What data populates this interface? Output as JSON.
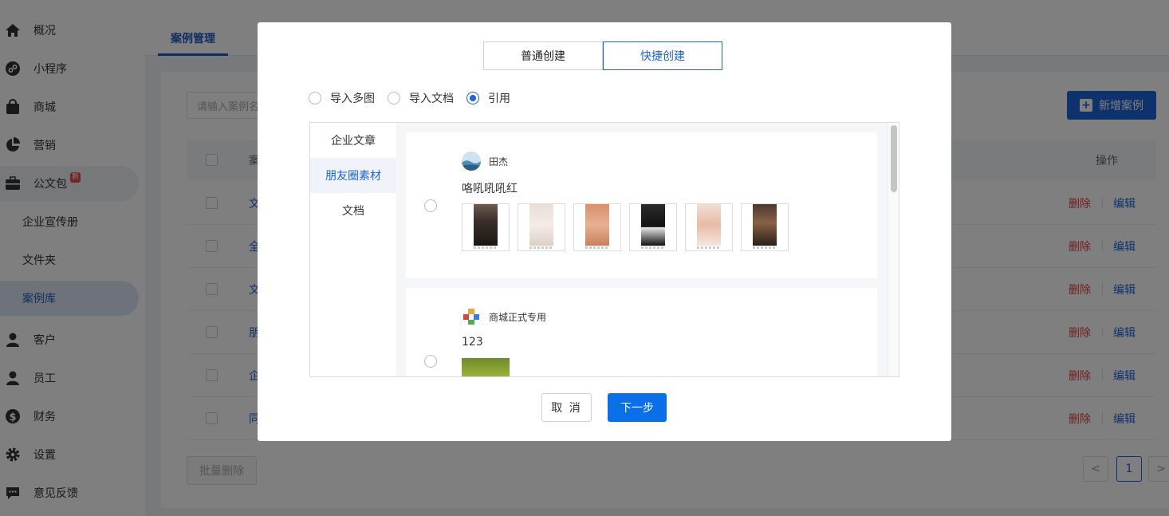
{
  "sidebar": {
    "items": [
      {
        "label": "概况",
        "icon": "home-icon"
      },
      {
        "label": "小程序",
        "icon": "mini-program-icon"
      },
      {
        "label": "商城",
        "icon": "shopping-bag-icon"
      },
      {
        "label": "营销",
        "icon": "pie-chart-icon"
      },
      {
        "label": "公文包",
        "icon": "briefcase-icon",
        "badge": "新"
      },
      {
        "label": "客户",
        "icon": "customer-icon"
      },
      {
        "label": "员工",
        "icon": "person-icon"
      },
      {
        "label": "财务",
        "icon": "dollar-icon"
      },
      {
        "label": "设置",
        "icon": "gear-icon"
      },
      {
        "label": "意见反馈",
        "icon": "feedback-icon"
      }
    ],
    "subitems": [
      "企业宣传册",
      "文件夹",
      "案例库"
    ],
    "active_subitem": "案例库"
  },
  "main": {
    "tab": "案例管理",
    "search_placeholder": "请输入案例名",
    "add_button": "新增案例",
    "table": {
      "first_col_header": "案",
      "action_header": "操作",
      "rows": [
        {
          "first": "文",
          "delete": "删除",
          "edit": "编辑"
        },
        {
          "first": "全",
          "delete": "删除",
          "edit": "编辑"
        },
        {
          "first": "文",
          "delete": "删除",
          "edit": "编辑"
        },
        {
          "first": "朋",
          "delete": "删除",
          "edit": "编辑"
        },
        {
          "first": "企",
          "delete": "删除",
          "edit": "编辑"
        },
        {
          "first": "同",
          "delete": "删除",
          "edit": "编辑"
        }
      ]
    },
    "batch_delete": "批量删除",
    "pagination": {
      "prev": "<",
      "current": "1",
      "next": ">"
    }
  },
  "modal": {
    "tabs": [
      "普通创建",
      "快捷创建"
    ],
    "active_tab": "快捷创建",
    "import_options": [
      "导入多图",
      "导入文档",
      "引用"
    ],
    "selected_option": "引用",
    "categories": [
      "企业文章",
      "朋友圈素材",
      "文档"
    ],
    "active_category": "朋友圈素材",
    "posts": [
      {
        "author": "田杰",
        "text": "咯吼吼吼红",
        "image_count": 6,
        "avatar": "avatar-photo"
      },
      {
        "author": "商城正式专用",
        "text": "123",
        "image_count": 1,
        "avatar": "colorful-logo"
      }
    ],
    "cancel_button": "取 消",
    "next_button": "下一步"
  },
  "colors": {
    "primary": "#1c64d8",
    "next_button": "#0a6fe8",
    "danger": "#e23d3d",
    "overlay": "rgba(0,0,0,0.5)"
  }
}
